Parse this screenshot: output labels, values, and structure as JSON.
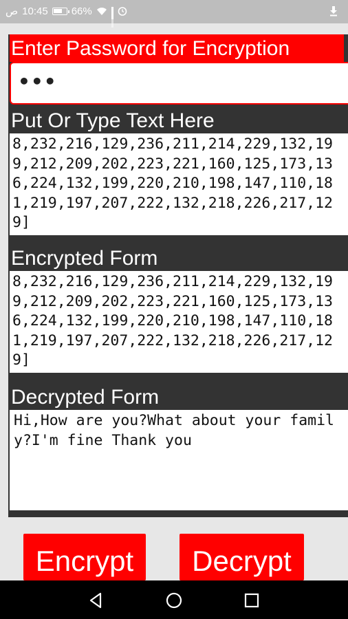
{
  "status_bar": {
    "carrier": "ص",
    "time": "10:45",
    "battery": "66%",
    "battery_level": 0.66,
    "icons": [
      "battery-icon",
      "wifi-icon",
      "signal-icon",
      "alarm-icon",
      "download-icon"
    ]
  },
  "password": {
    "title": "Enter Password for Encryption",
    "value": "•••"
  },
  "input": {
    "label": "Put Or Type Text Here",
    "text": "8,232,216,129,236,211,214,229,132,199,212,209,202,223,221,160,125,173,136,224,132,199,220,210,198,147,110,181,219,197,207,222,132,218,226,217,129]"
  },
  "encrypted": {
    "label": "Encrypted Form",
    "text": "8,232,216,129,236,211,214,229,132,199,212,209,202,223,221,160,125,173,136,224,132,199,220,210,198,147,110,181,219,197,207,222,132,218,226,217,129]"
  },
  "decrypted": {
    "label": "Decrypted Form",
    "text": "Hi,How are you?What about your family?I'm fine Thank you"
  },
  "buttons": {
    "encrypt": "Encrypt",
    "decrypt": "Decrypt"
  },
  "nav": {
    "icons": [
      "back-icon",
      "home-icon",
      "recent-apps-icon"
    ]
  },
  "colors": {
    "accent": "#ff0000",
    "section_bg": "#333333",
    "status_bar": "#bdbdbd"
  }
}
